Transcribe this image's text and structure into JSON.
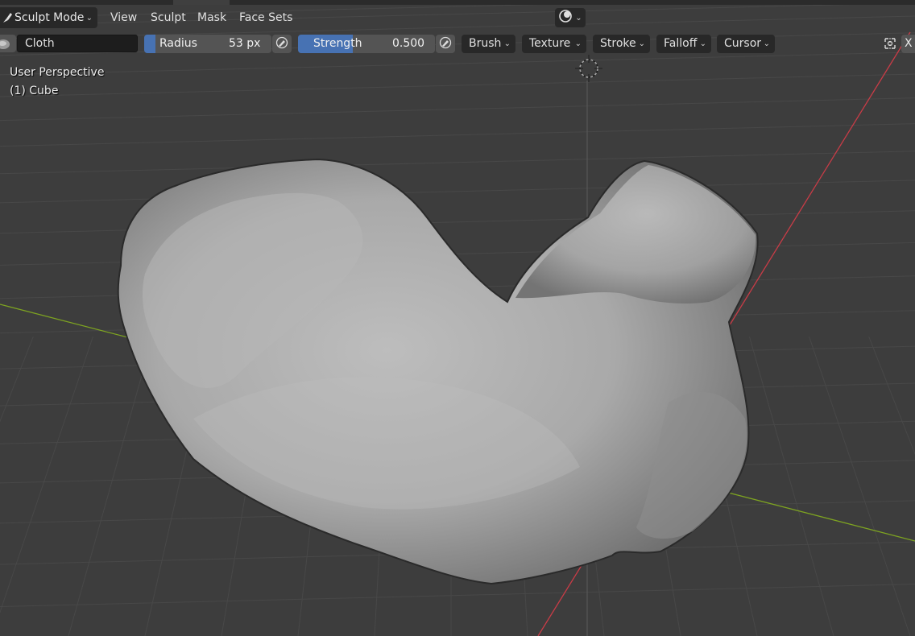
{
  "header": {
    "mode": "Sculpt Mode",
    "menus": [
      "View",
      "Sculpt",
      "Mask",
      "Face Sets"
    ]
  },
  "toolbar": {
    "brush_name": "Cloth",
    "radius": {
      "label": "Radius",
      "value": "53 px"
    },
    "strength": {
      "label": "Strength",
      "value": "0.500",
      "fill_fraction": 0.4
    },
    "dropdowns": [
      "Brush",
      "Texture",
      "Stroke",
      "Falloff",
      "Cursor"
    ],
    "axis_label": "X"
  },
  "viewport": {
    "perspective": "User Perspective",
    "object": "(1) Cube"
  },
  "icons": {
    "mode": "sculpt-brush-icon",
    "shading": "overlay-shading-icon",
    "pen_pressure": "pen-pressure-icon",
    "symmetry": "symmetry-icon",
    "cursor": "3d-cursor-icon"
  },
  "colors": {
    "background": "#3d3d3d",
    "accent": "#4772b3",
    "x_axis": "#c93c47",
    "y_axis": "#7ea421"
  }
}
